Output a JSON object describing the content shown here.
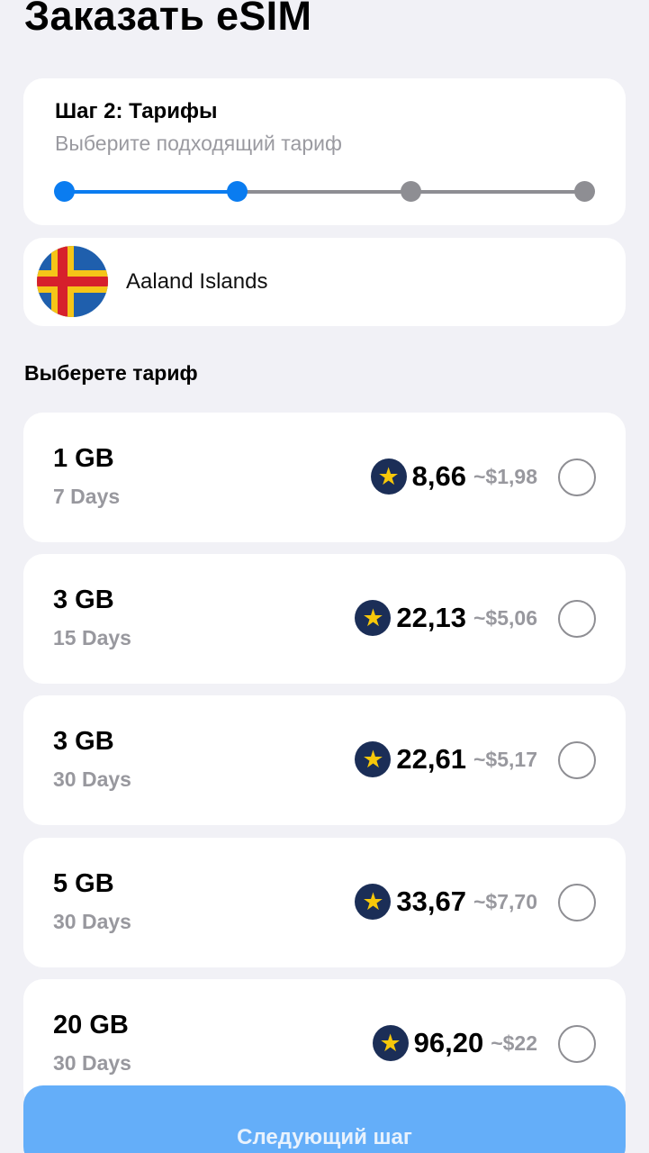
{
  "page": {
    "title": "Заказать eSIM"
  },
  "step": {
    "title": "Шаг 2: Тарифы",
    "subtitle": "Выберите подходящий тариф",
    "current": 2,
    "total": 4
  },
  "country": {
    "name": "Aaland Islands",
    "flag_icon": "aland-islands-flag"
  },
  "section_label": "Выберете тариф",
  "plans": [
    {
      "data": "1 GB",
      "days": "7 Days",
      "stars": "8,66",
      "usd": "~$1,98",
      "selected": false
    },
    {
      "data": "3 GB",
      "days": "15 Days",
      "stars": "22,13",
      "usd": "~$5,06",
      "selected": false
    },
    {
      "data": "3 GB",
      "days": "30 Days",
      "stars": "22,61",
      "usd": "~$5,17",
      "selected": false
    },
    {
      "data": "5 GB",
      "days": "30 Days",
      "stars": "33,67",
      "usd": "~$7,70",
      "selected": false
    },
    {
      "data": "20 GB",
      "days": "30 Days",
      "stars": "96,20",
      "usd": "~$22",
      "selected": false
    }
  ],
  "next_button": {
    "label": "Следующий шаг"
  },
  "colors": {
    "accent": "#0a7cf0",
    "button": "#64aef9",
    "star_badge": "#1b2e57",
    "star": "#f7c80a",
    "muted": "#98989e",
    "background": "#f1f1f6"
  }
}
